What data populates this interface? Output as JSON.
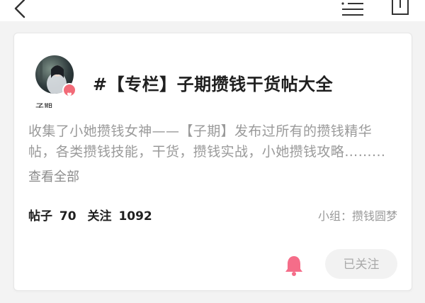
{
  "topbar": {
    "back_icon": "chevron-left-icon",
    "list_icon": "list-icon",
    "share_icon": "share-icon"
  },
  "card": {
    "owner_name": "子期",
    "title": "#【专栏】子期攒钱干货帖大全",
    "description_lines": [
      "收集了小她攒钱女神——【子期】发布过所有的攒钱精华",
      "帖，各类攒钱技能，干货，攒钱实战，小她攒钱攻略……..."
    ],
    "see_all": "查看全部",
    "stats": {
      "posts_label": "帖子",
      "posts_count": "70",
      "follows_label": "关注",
      "follows_count": "1092"
    },
    "group": "小组：攒钱圆梦",
    "follow_button": "已关注",
    "colors": {
      "bell": "#f56d89",
      "badge": "#f26b78",
      "muted_text": "#9a9a9a"
    }
  }
}
